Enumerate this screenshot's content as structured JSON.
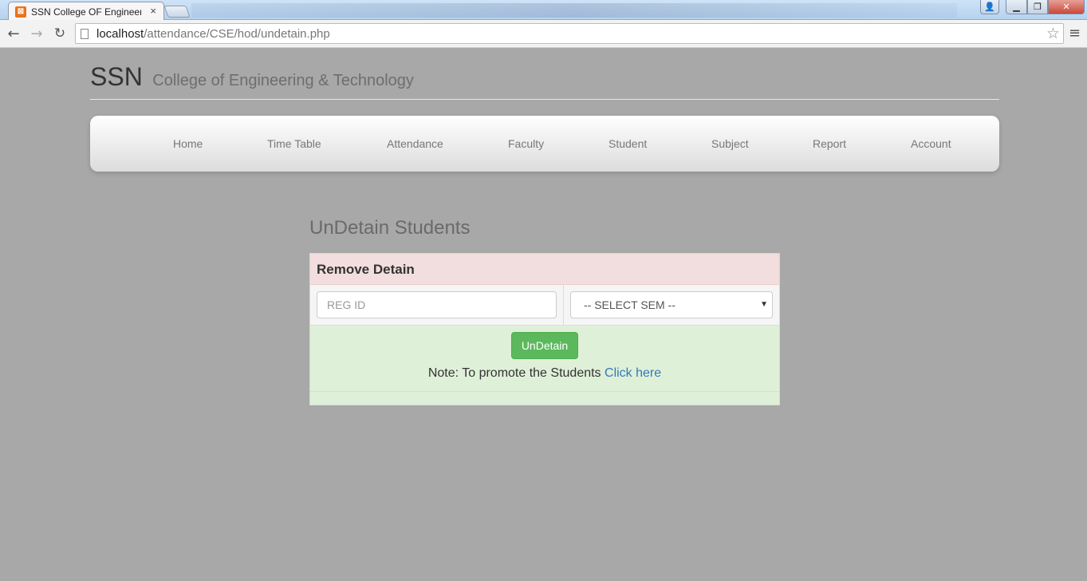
{
  "browser": {
    "tab_title": "SSN College OF Engineeri",
    "tab_favicon": "xampp-icon",
    "tab_close": "×",
    "url_host": "localhost",
    "url_path": "/attendance/CSE/hod/undetain.php"
  },
  "header": {
    "brand": "SSN",
    "subtitle": "College of Engineering & Technology"
  },
  "nav": {
    "items": [
      "Home",
      "Time Table",
      "Attendance",
      "Faculty",
      "Student",
      "Subject",
      "Report",
      "Account"
    ]
  },
  "main": {
    "title": "UnDetain Students",
    "panel": {
      "heading": "Remove Detain",
      "reg_placeholder": "REG ID",
      "sem_selected": "-- SELECT SEM --",
      "button_label": "UnDetain",
      "note_text": "Note: To promote the Students",
      "note_link": "Click here"
    }
  },
  "colors": {
    "panel_heading_bg": "#f2dede",
    "panel_footer_bg": "#dff0d8",
    "button_green": "#5cb85c",
    "link_blue": "#337ab7",
    "page_bg": "#a8a8a8"
  }
}
